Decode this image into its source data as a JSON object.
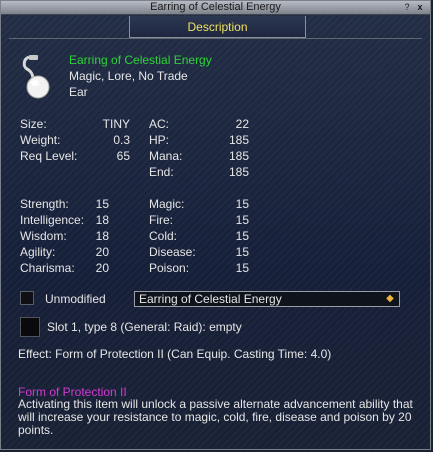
{
  "window": {
    "title": "Earring of Celestial Energy",
    "help_label": "?",
    "close_label": "x"
  },
  "tabs": {
    "description": "Description"
  },
  "item": {
    "name": "Earring of Celestial Energy",
    "flags": "Magic, Lore, No Trade",
    "slot": "Ear",
    "icon": "earring-icon"
  },
  "stats": {
    "size": {
      "label": "Size:",
      "value": "TINY"
    },
    "weight": {
      "label": "Weight:",
      "value": "0.3"
    },
    "req_level": {
      "label": "Req Level:",
      "value": "65"
    },
    "ac": {
      "label": "AC:",
      "value": "22"
    },
    "hp": {
      "label": "HP:",
      "value": "185"
    },
    "mana": {
      "label": "Mana:",
      "value": "185"
    },
    "end": {
      "label": "End:",
      "value": "185"
    }
  },
  "attributes": {
    "strength": {
      "label": "Strength:",
      "value": "15"
    },
    "intelligence": {
      "label": "Intelligence:",
      "value": "18"
    },
    "wisdom": {
      "label": "Wisdom:",
      "value": "18"
    },
    "agility": {
      "label": "Agility:",
      "value": "20"
    },
    "charisma": {
      "label": "Charisma:",
      "value": "20"
    }
  },
  "resists": {
    "magic": {
      "label": "Magic:",
      "value": "15"
    },
    "fire": {
      "label": "Fire:",
      "value": "15"
    },
    "cold": {
      "label": "Cold:",
      "value": "15"
    },
    "disease": {
      "label": "Disease:",
      "value": "15"
    },
    "poison": {
      "label": "Poison:",
      "value": "15"
    }
  },
  "unmodified": {
    "label": "Unmodified",
    "checked": false,
    "select_value": "Earring of Celestial Energy"
  },
  "augment_slot": {
    "label": "Slot 1, type 8 (General: Raid): empty"
  },
  "effect": {
    "text": "Effect: Form of Protection II (Can Equip. Casting Time: 4.0)"
  },
  "spell": {
    "name": "Form of Protection II",
    "description": "Activating this item will unlock a passive alternate advancement ability that will increase your resistance to magic, cold, fire, disease and poison by 20 points."
  },
  "colors": {
    "item_name": "#2fd23a",
    "tab_label": "#f0e060",
    "spell_name": "#d23ad2",
    "select_arrow": "#e8b53a"
  }
}
